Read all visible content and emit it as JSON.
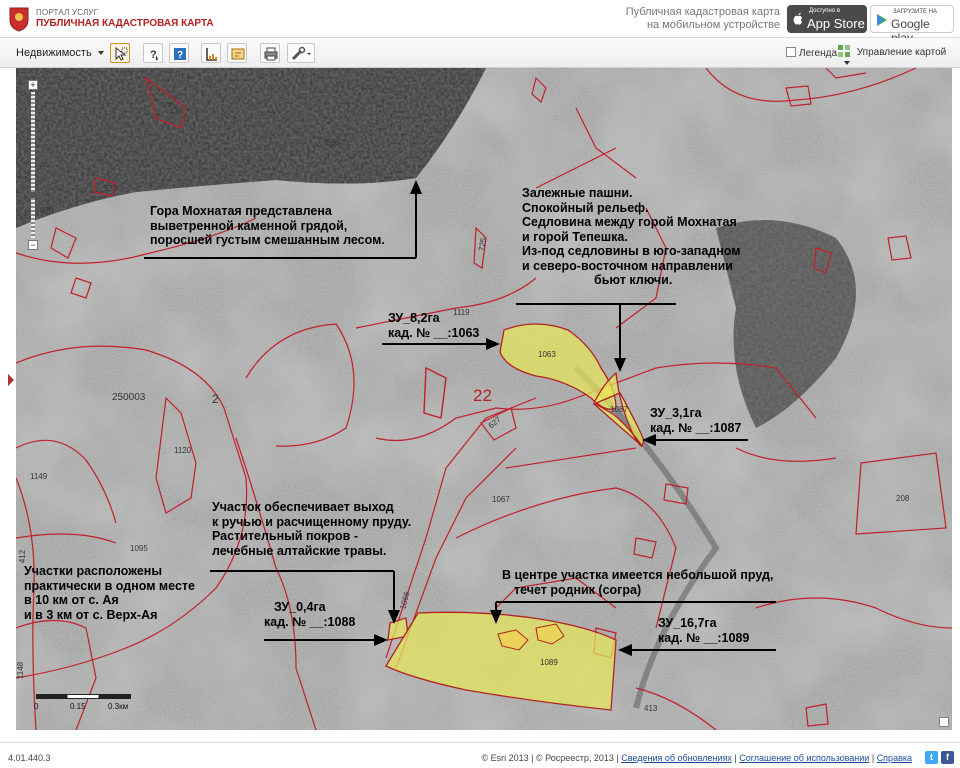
{
  "header": {
    "portal_name": "ПОРТАЛ УСЛУГ",
    "map_name": "ПУБЛИЧНАЯ КАДАСТРОВАЯ КАРТА",
    "mobile_line1": "Публичная кадастровая карта",
    "mobile_line2": "на мобильном устройстве",
    "appstore_small": "Доступно в",
    "appstore_big": "App Store",
    "googleplay_small": "ЗАГРУЗИТЕ НА",
    "googleplay_big": "Google play"
  },
  "toolbar": {
    "layer_value": "Недвижимость",
    "legend_label": "Легенда",
    "map_control_label": "Управление картой",
    "tools": [
      "select-tool-icon",
      "identify-tool-icon",
      "help-tool-icon",
      "measure-tool-icon",
      "cadastral-tool-icon",
      "print-tool-icon",
      "link-tool-icon"
    ]
  },
  "map": {
    "zoom_in": "+",
    "zoom_out": "−",
    "scale_labels": [
      "0",
      "0.15",
      "0.3км"
    ],
    "region_labels": {
      "n22": "22",
      "n250003": "250003",
      "n2": "2",
      "n1120": "1120",
      "n1149": "1149",
      "n1095": "1095",
      "n412": "412",
      "n1148": "1148",
      "n1119": "1119",
      "n1067": "1067",
      "n208": "208",
      "n413": "413",
      "n566": "566",
      "n572": "572",
      "n571": "571",
      "n570": "570",
      "n725": "725",
      "n627": "627",
      "n1066": "1066",
      "n1063": "1063",
      "n1087": "1087",
      "n1089": "1089"
    },
    "annotations": {
      "mountain": [
        "Гора Мохнатая представлена",
        "выветренной каменной грядой,",
        "поросшей густым смешанным лесом."
      ],
      "fields": [
        "Залежные пашни.",
        "Спокойный рельеф.",
        "Седловина между горой Мохнатая",
        "и горой Тепешка.",
        "Из-под седловины в юго-западном",
        "и северо-восточном направлении",
        "бьют ключи."
      ],
      "zu1063": [
        "ЗУ_8,2га",
        "кад. № __:1063"
      ],
      "zu1087": [
        "ЗУ_3,1га",
        "кад. № __:1087"
      ],
      "access": [
        "Участок обеспечивает выход",
        "к ручью и расчищенному пруду.",
        "Растительный покров -",
        "лечебные алтайские травы."
      ],
      "location": [
        "Участки расположены",
        "практически в одном месте",
        "в 10 км от с. Ая",
        "и в 3 км от с. Верх-Ая"
      ],
      "zu1088": [
        "ЗУ_0,4га",
        "кад. № __:1088"
      ],
      "pond": [
        "В центре участка имеется небольшой пруд,",
        "течет родник (согра)"
      ],
      "zu1089": [
        "ЗУ_16,7га",
        "кад. № __:1089"
      ]
    },
    "colors": {
      "parcel_highlight": "#e8e85a",
      "boundary": "#c0202a",
      "annotation_line": "#000000"
    }
  },
  "footer": {
    "version": "4.01.440.3",
    "copyright_esri": "© Esri 2013 | © Росреестр, 2013 |",
    "link_updates": "Сведения об обновлениях",
    "link_terms": "Соглашение об использовании",
    "link_help": "Справка"
  }
}
